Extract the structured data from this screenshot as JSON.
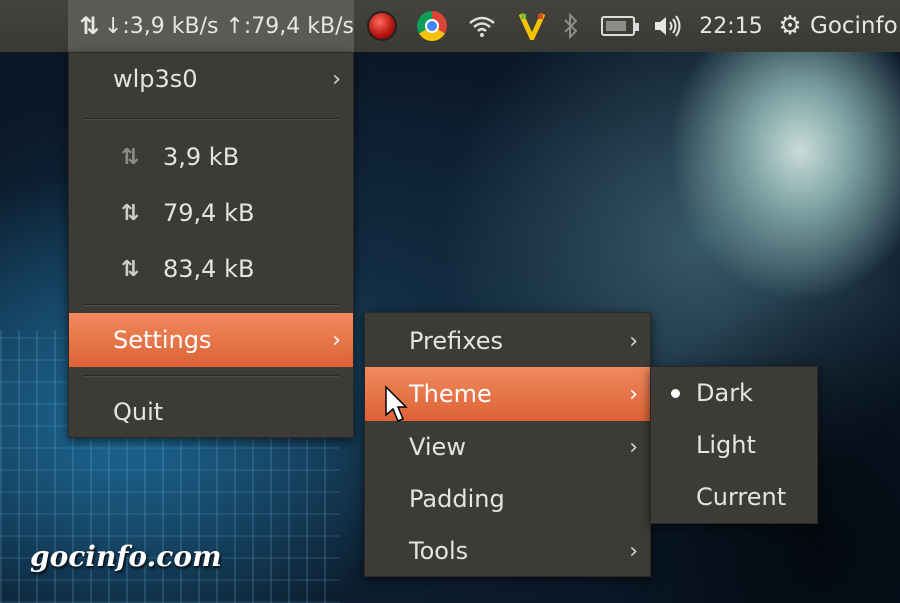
{
  "panel": {
    "netspeed": "↓:3,9 kB/s ↑:79,4 kB/s",
    "clock": "22:15",
    "user": "Gocinfo"
  },
  "icons": {
    "netspeed": "up-down-arrows-icon",
    "record": "record-icon",
    "chrome": "chrome-icon",
    "wifi": "wifi-icon",
    "app_v": "v-app-icon",
    "bluetooth": "bluetooth-icon",
    "battery": "battery-icon",
    "volume": "volume-icon",
    "gear": "gear-icon"
  },
  "main_menu": {
    "interface": "wlp3s0",
    "stats": [
      {
        "value": "3,9 kB",
        "icon": "download-arrows-icon"
      },
      {
        "value": "79,4 kB",
        "icon": "upload-arrows-icon"
      },
      {
        "value": "83,4 kB",
        "icon": "total-arrows-icon"
      }
    ],
    "settings": "Settings",
    "quit": "Quit"
  },
  "settings_menu": {
    "items": [
      "Prefixes",
      "Theme",
      "View",
      "Padding",
      "Tools"
    ],
    "active": "Theme"
  },
  "theme_menu": {
    "items": [
      "Dark",
      "Light",
      "Current"
    ],
    "selected": "Dark"
  },
  "watermark": "gocinfo.com",
  "colors": {
    "panel_bg": "#3c3b37",
    "menu_bg": "#3c3b37",
    "highlight": "#e5703f",
    "text": "#e6e4df"
  }
}
